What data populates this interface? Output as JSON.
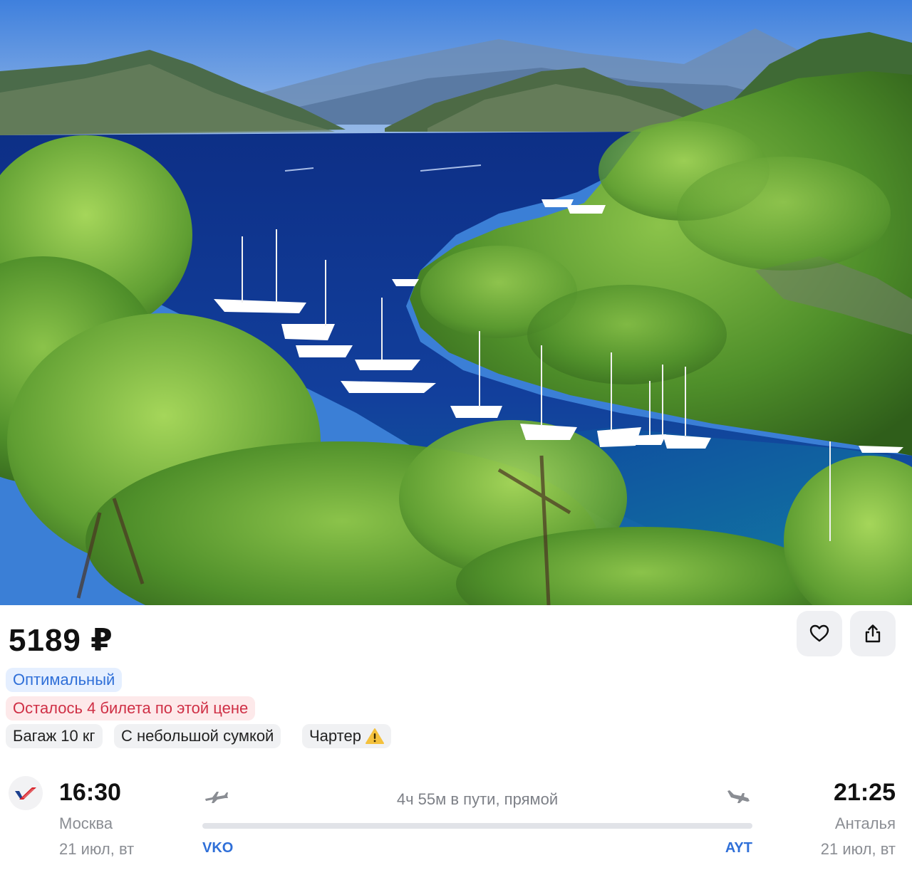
{
  "hero": {
    "image_subject": "photo-bay-yachts-pine-trees",
    "colors": {
      "sky": "#5b8fe0",
      "sea": "#123f9c",
      "forest": "#4f8f2a"
    }
  },
  "offer": {
    "price": "5189 ₽",
    "favorite_icon": "heart-outline-icon",
    "share_icon": "share-icon"
  },
  "tags": {
    "optimal": "Оптимальный",
    "seats_left": "Осталось 4 билета по этой цене",
    "baggage": "Багаж 10 кг",
    "hand_luggage": "С небольшой сумкой",
    "charter": "Чартер"
  },
  "flight": {
    "airline_logo": "airline-logo-icon",
    "departure": {
      "time": "16:30",
      "city": "Москва",
      "date": "21 июл, вт",
      "code": "VKO"
    },
    "arrival": {
      "time": "21:25",
      "city": "Анталья",
      "date": "21 июл, вт",
      "code": "AYT"
    },
    "duration": "4ч 55м в пути, прямой"
  },
  "colors": {
    "accent": "#2f6fd8",
    "warning_red": "#cf2f45",
    "muted": "#8a8d93"
  }
}
